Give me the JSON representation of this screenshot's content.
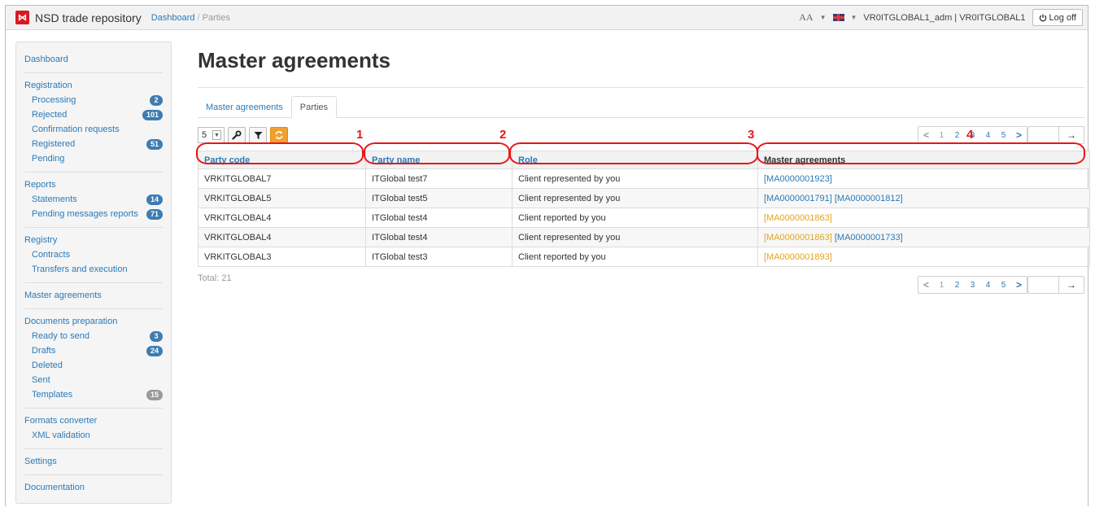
{
  "header": {
    "logo_glyph": "⋈",
    "brand": "NSD trade repository",
    "breadcrumb": [
      "Dashboard",
      "Parties"
    ],
    "font_size_control": "AA",
    "user": "VR0ITGLOBAL1_adm | VR0ITGLOBAL1",
    "logoff_label": "Log off"
  },
  "sidebar": {
    "groups": [
      {
        "items": [
          {
            "label": "Dashboard"
          }
        ]
      },
      {
        "items": [
          {
            "label": "Registration"
          },
          {
            "label": "Processing",
            "badge": "2"
          },
          {
            "label": "Rejected",
            "badge": "101"
          },
          {
            "label": "Confirmation requests"
          },
          {
            "label": "Registered",
            "badge": "51"
          },
          {
            "label": "Pending"
          }
        ]
      },
      {
        "items": [
          {
            "label": "Reports"
          },
          {
            "label": "Statements",
            "badge": "14"
          },
          {
            "label": "Pending messages reports",
            "badge": "71"
          }
        ]
      },
      {
        "items": [
          {
            "label": "Registry"
          },
          {
            "label": "Contracts"
          },
          {
            "label": "Transfers and execution"
          }
        ]
      },
      {
        "items": [
          {
            "label": "Master agreements"
          }
        ]
      },
      {
        "items": [
          {
            "label": "Documents preparation"
          },
          {
            "label": "Ready to send",
            "badge": "3"
          },
          {
            "label": "Drafts",
            "badge": "24"
          },
          {
            "label": "Deleted"
          },
          {
            "label": "Sent"
          },
          {
            "label": "Templates",
            "badge": "15"
          }
        ]
      },
      {
        "items": [
          {
            "label": "Formats converter"
          },
          {
            "label": "XML validation"
          }
        ]
      },
      {
        "items": [
          {
            "label": "Settings"
          }
        ]
      },
      {
        "items": [
          {
            "label": "Documentation"
          }
        ]
      }
    ]
  },
  "main": {
    "title": "Master agreements",
    "tabs": [
      {
        "label": "Master agreements"
      },
      {
        "label": "Parties"
      }
    ],
    "page_size": "5",
    "pagination": {
      "pages": [
        "1",
        "2",
        "3",
        "4",
        "5"
      ],
      "current": "1",
      "prev": "<",
      "next": ">",
      "go": "→"
    },
    "table": {
      "columns": [
        "Party code",
        "Party name",
        "Role",
        "Master agreements"
      ],
      "rows": [
        {
          "party_code": "VRKITGLOBAL7",
          "party_name": "ITGlobal test7",
          "role": "Client represented by you",
          "agreements": [
            "[MA0000001923]"
          ]
        },
        {
          "party_code": "VRKITGLOBAL5",
          "party_name": "ITGlobal test5",
          "role": "Client represented by you",
          "agreements": [
            "[MA0000001791]",
            "[MA0000001812]"
          ]
        },
        {
          "party_code": "VRKITGLOBAL4",
          "party_name": "ITGlobal test4",
          "role": "Client reported by you",
          "agreements": [
            "[MA0000001863]"
          ]
        },
        {
          "party_code": "VRKITGLOBAL4",
          "party_name": "ITGlobal test4",
          "role": "Client represented by you",
          "agreements": [
            "[MA0000001863]",
            "[MA0000001733]"
          ]
        },
        {
          "party_code": "VRKITGLOBAL3",
          "party_name": "ITGlobal test3",
          "role": "Client reported by you",
          "agreements": [
            "[MA0000001893]"
          ]
        }
      ]
    },
    "total": "Total: 21"
  },
  "annotations": {
    "markers": [
      "1",
      "2",
      "3",
      "4"
    ],
    "color": "#e8161a"
  },
  "colors": {
    "link": "#2a7ab8",
    "orange_link": "#e4a41b",
    "badge": "#3e7cb1",
    "brand_red": "#d71a21"
  }
}
